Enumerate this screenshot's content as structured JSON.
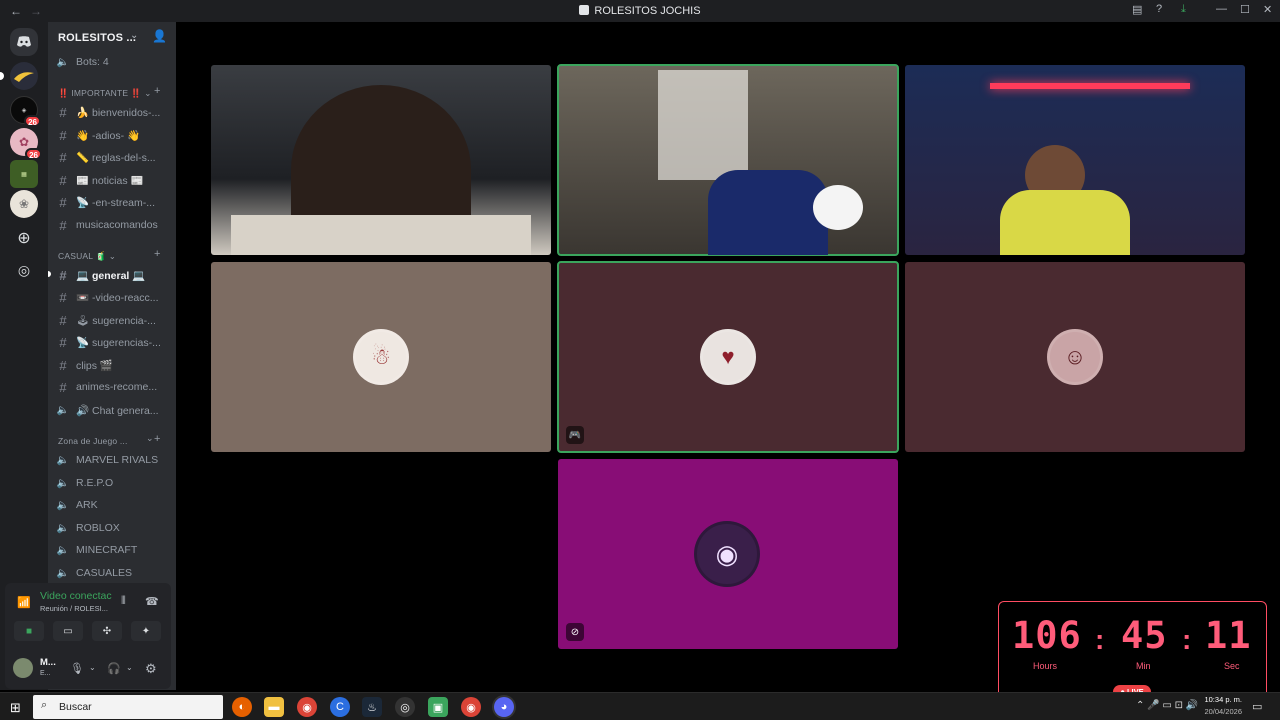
{
  "window": {
    "title": "ROLESITOS JOCHIS"
  },
  "server": {
    "name": "ROLESITOS ..."
  },
  "channels": {
    "bots": "Bots: 4",
    "cat_importante": "‼️ IMPORTANTE ‼️",
    "important": [
      "🍌 bienvenidos-...",
      "👋 -adios- 👋",
      "📏 reglas-del-s...",
      "📰 noticias 📰",
      "📡 -en-stream-...",
      "musicacomandos"
    ],
    "cat_casual": "CASUAL 🧃",
    "casual": [
      "💻 general 💻",
      "📼 -video-reacc...",
      "🕹 sugerencia-...",
      "📡 sugerencias-...",
      "clips 🎬",
      "animes-recome...",
      "🔊 Chat genera..."
    ],
    "cat_zona": "Zona de Juego ...",
    "voice": [
      "MARVEL RIVALS",
      "R.E.P.O",
      "ARK",
      "ROBLOX",
      "MINECRAFT",
      "CASUALES"
    ]
  },
  "voice_panel": {
    "status": "Video conectac",
    "channel": "Reunión / ROLESI...",
    "user": "M...",
    "user_sub": "E..."
  },
  "rail": {
    "badge1": "26",
    "badge2": "26"
  },
  "timer": {
    "hours": "106",
    "minutes": "45",
    "seconds": "11",
    "hours_label": "Hours",
    "min_label": "Min",
    "sec_label": "Sec",
    "live": "● LIVE"
  },
  "taskbar": {
    "search": "Buscar",
    "time": "10:34 p. m.",
    "date": "20/04/2026"
  },
  "colors": {
    "speaking": "#3ba55d",
    "tile_brown": "#7d6c62",
    "tile_maroon": "#4a2a30",
    "tile_magenta": "#880d76",
    "live_red": "#ed4245",
    "timer_pink": "#ff5c7a"
  }
}
